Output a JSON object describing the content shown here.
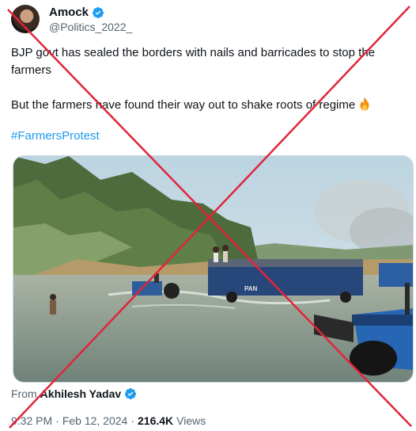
{
  "author": {
    "display_name": "Amock",
    "handle": "@Politics_2022_",
    "verified": true
  },
  "tweet": {
    "line1": "BJP govt has sealed the borders with nails and barricades to stop the farmers",
    "line2": "But the farmers have found their way out to shake roots of regime",
    "hashtag": "#FarmersProtest"
  },
  "media": {
    "trailer_label": "PAN"
  },
  "source": {
    "from_label": "From",
    "from_name": "Akhilesh Yadav",
    "verified": true
  },
  "meta": {
    "time": "9:32 PM",
    "separator": "·",
    "date": "Feb 12, 2024",
    "views_count": "216.4K",
    "views_label": "Views"
  },
  "overlay": {
    "cross_color": "#e0253a"
  },
  "colors": {
    "link": "#1d9bf0",
    "verified_badge": "#1d9bf0",
    "muted_text": "#536471"
  }
}
